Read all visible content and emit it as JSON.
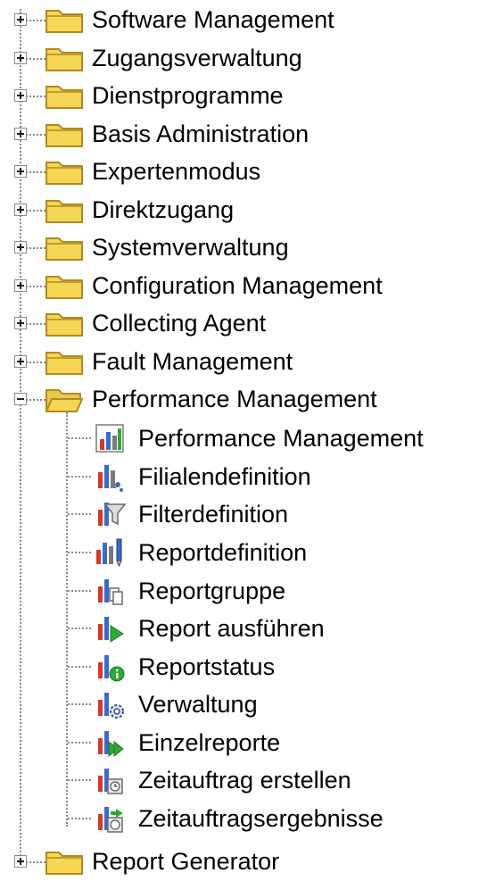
{
  "tree": {
    "top_nodes": [
      {
        "label": "Software Management",
        "icon": "folder-closed-icon",
        "expanded": false
      },
      {
        "label": "Zugangsverwaltung",
        "icon": "folder-closed-icon",
        "expanded": false
      },
      {
        "label": "Dienstprogramme",
        "icon": "folder-closed-icon",
        "expanded": false
      },
      {
        "label": "Basis Administration",
        "icon": "folder-closed-icon",
        "expanded": false
      },
      {
        "label": "Expertenmodus",
        "icon": "folder-closed-icon",
        "expanded": false
      },
      {
        "label": "Direktzugang",
        "icon": "folder-closed-icon",
        "expanded": false
      },
      {
        "label": "Systemverwaltung",
        "icon": "folder-closed-icon",
        "expanded": false
      },
      {
        "label": "Configuration Management",
        "icon": "folder-closed-icon",
        "expanded": false
      },
      {
        "label": "Collecting Agent",
        "icon": "folder-closed-icon",
        "expanded": false
      },
      {
        "label": "Fault Management",
        "icon": "folder-closed-icon",
        "expanded": false
      },
      {
        "label": "Performance Management",
        "icon": "folder-open-icon",
        "expanded": true
      }
    ],
    "performance_children": [
      {
        "label": "Performance Management",
        "icon": "bar-chart-icon"
      },
      {
        "label": "Filialendefinition",
        "icon": "chart-branch-icon"
      },
      {
        "label": "Filterdefinition",
        "icon": "chart-filter-icon"
      },
      {
        "label": "Reportdefinition",
        "icon": "chart-pencil-icon"
      },
      {
        "label": "Reportgruppe",
        "icon": "chart-pages-icon"
      },
      {
        "label": "Report ausführen",
        "icon": "chart-play-icon"
      },
      {
        "label": "Reportstatus",
        "icon": "chart-info-icon"
      },
      {
        "label": "Verwaltung",
        "icon": "chart-gear-icon"
      },
      {
        "label": "Einzelreporte",
        "icon": "chart-forward-icon"
      },
      {
        "label": "Zeitauftrag erstellen",
        "icon": "chart-clock-icon"
      },
      {
        "label": "Zeitauftragsergebnisse",
        "icon": "chart-clock-result-icon"
      }
    ],
    "last_node": {
      "label": "Report Generator",
      "icon": "folder-closed-icon",
      "expanded": false
    },
    "colors": {
      "folder_fill": "#f5d655",
      "folder_stroke": "#b08a1e",
      "bar_red": "#d23a2a",
      "bar_blue": "#3b6bc9",
      "bar_gray": "#7a7a7a",
      "green": "#2ea836"
    }
  }
}
